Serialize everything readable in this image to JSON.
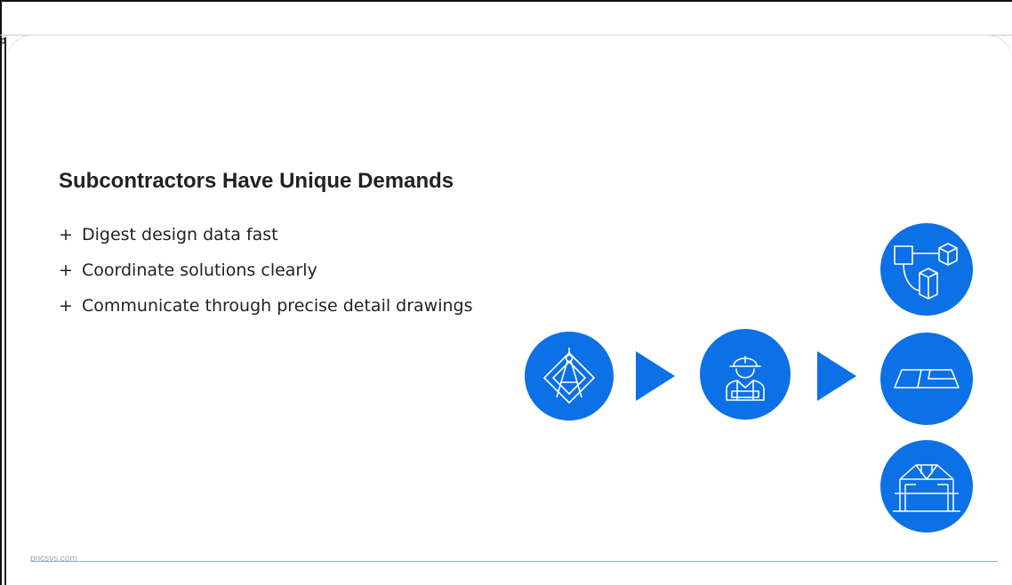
{
  "window": {
    "title_fragment": "p"
  },
  "slide": {
    "title": "Subcontractors Have Unique Demands",
    "bullets": [
      {
        "marker": "+",
        "text": "Digest design data fast"
      },
      {
        "marker": "+",
        "text": "Coordinate solutions clearly"
      },
      {
        "marker": "+",
        "text": "Communicate through precise detail drawings"
      }
    ],
    "footer": "bricsys.com"
  },
  "colors": {
    "accent": "#0c70e6",
    "icon_line": "#ffffff"
  },
  "icons": [
    "drafting-compass-icon",
    "construction-worker-icon",
    "3d-cubes-icon",
    "floor-plan-icon",
    "structural-frame-icon"
  ]
}
